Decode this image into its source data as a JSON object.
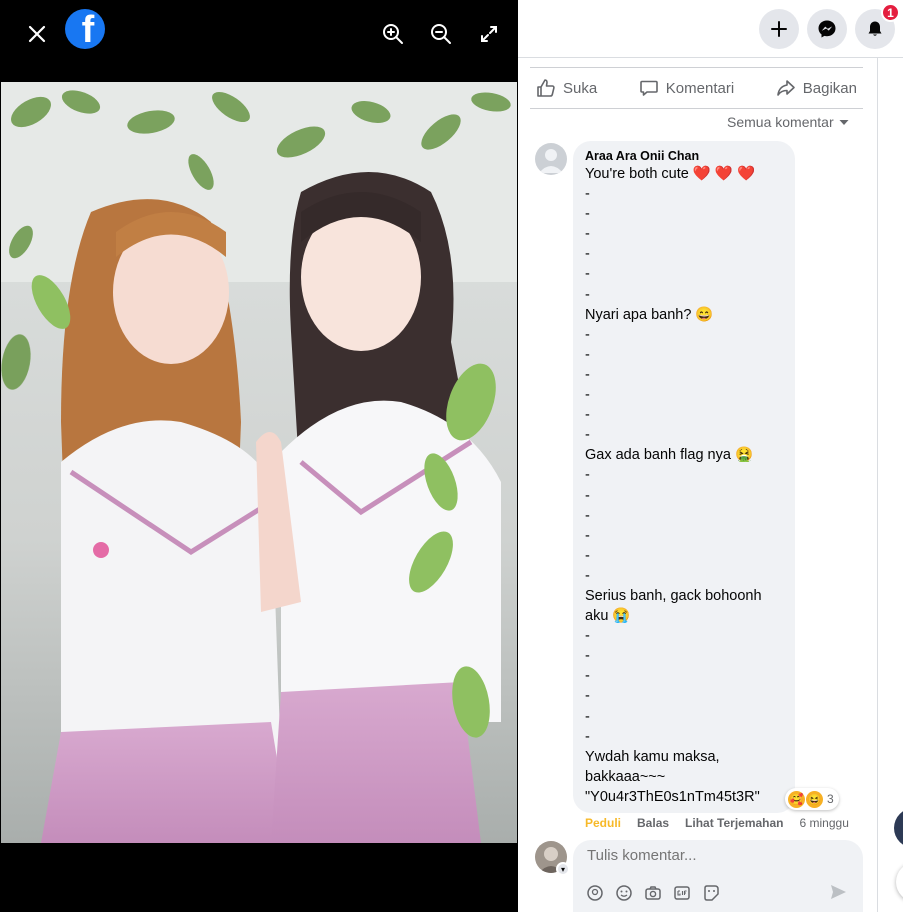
{
  "viewer": {
    "close_icon": "close-icon",
    "logo_icon": "facebook-logo",
    "zoom_in_icon": "zoom-in-icon",
    "zoom_out_icon": "zoom-out-icon",
    "fullscreen_icon": "fullscreen-icon"
  },
  "topbar": {
    "notifications_count": "1"
  },
  "actions": {
    "like": "Suka",
    "comment": "Komentari",
    "share": "Bagikan"
  },
  "sort_label": "Semua komentar",
  "comment": {
    "author": "Araa Ara Onii Chan",
    "lines": [
      "You're both cute ❤️ ❤️ ❤️",
      "-",
      "-",
      "-",
      "-",
      "-",
      "-",
      "Nyari apa banh? 😄",
      "-",
      "-",
      "-",
      "-",
      "-",
      "-",
      "Gax ada banh flag nya 🤮",
      "-",
      "-",
      "-",
      "-",
      "-",
      "-",
      "Serius banh, gack bohoonh",
      "aku 😭",
      "-",
      "-",
      "-",
      "-",
      "-",
      "-",
      "Ywdah kamu maksa,",
      "bakkaaa~~~",
      "\"Y0u4r3ThE0s1nTm45t3R\""
    ],
    "reaction_count": "3",
    "care_label": "Peduli",
    "reply_label": "Balas",
    "translate_label": "Lihat Terjemahan",
    "time": "6 minggu"
  },
  "composer": {
    "placeholder": "Tulis komentar..."
  },
  "colors": {
    "brand": "#1877f2",
    "badge": "#e41e3f",
    "care": "#f7b928",
    "bubble": "#f0f2f5"
  }
}
